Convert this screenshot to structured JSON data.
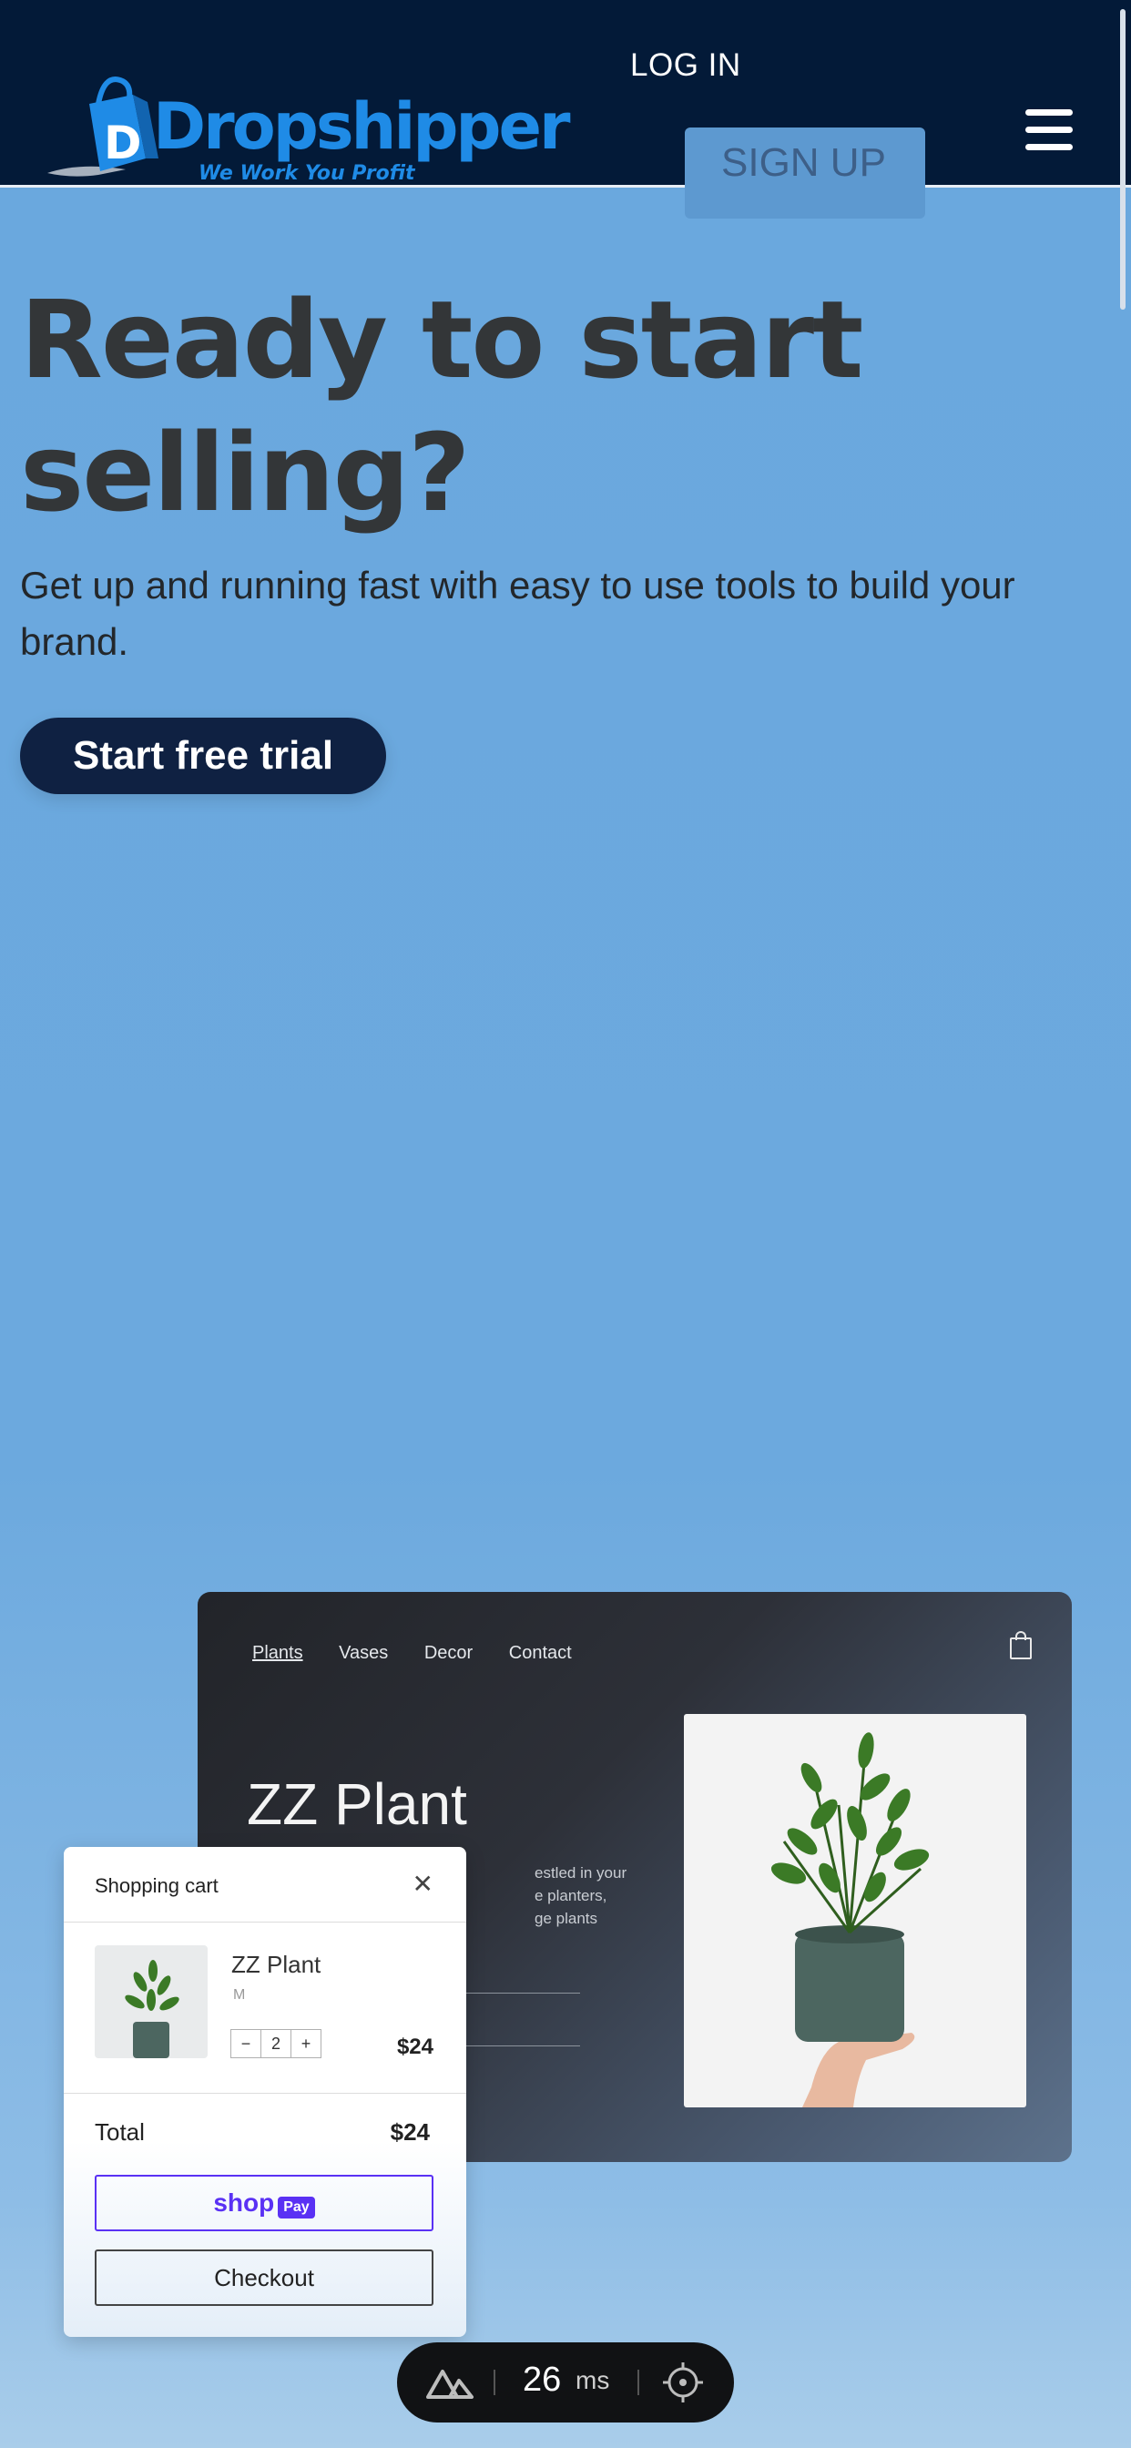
{
  "header": {
    "logo_name": "Dropshipper",
    "logo_tagline": "We Work You Profit",
    "login_label": "LOG IN",
    "signup_label": "SIGN UP",
    "menu_icon": "hamburger-menu-icon"
  },
  "hero": {
    "title": "Ready to start selling?",
    "subtitle": "Get up and running fast with easy to use tools to build your brand.",
    "cta_label": "Start free trial"
  },
  "store_preview": {
    "nav": [
      "Plants",
      "Vases",
      "Decor",
      "Contact"
    ],
    "active_nav": "Plants",
    "bag_icon": "shopping-bag-icon",
    "product_title": "ZZ Plant",
    "product_desc_lines": [
      "estled in your",
      "e planters,",
      "ge plants"
    ]
  },
  "cart": {
    "title": "Shopping cart",
    "close_icon": "close-icon",
    "item_name": "ZZ Plant",
    "item_variant": "M",
    "qty_minus": "−",
    "qty_value": "2",
    "qty_plus": "+",
    "item_price": "$24",
    "total_label": "Total",
    "total_value": "$24",
    "shoppay_word": "shop",
    "shoppay_badge": "Pay",
    "checkout_label": "Checkout"
  },
  "perf_overlay": {
    "value": "26",
    "unit": "ms"
  },
  "colors": {
    "header_bg": "#031a38",
    "page_bg": "#6aa8de",
    "cta_bg": "#0f2142",
    "brand_blue": "#1f8be6",
    "shoppay_purple": "#5a31f4"
  }
}
